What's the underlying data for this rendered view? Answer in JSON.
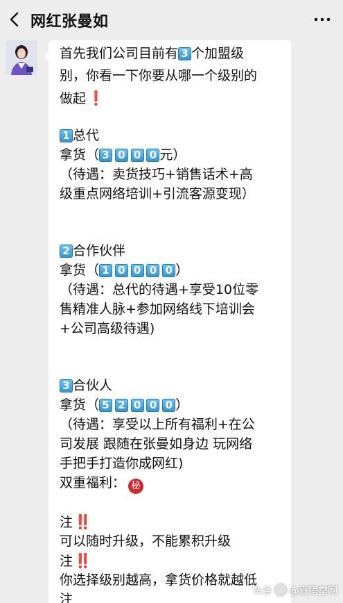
{
  "header": {
    "title": "网红张曼如",
    "back_icon": "chevron-left-icon",
    "more_icon": "ellipsis-icon"
  },
  "message": {
    "avatar_icon": "avatar",
    "bubble_color": "#ffffff",
    "box_color": "#2f93d8",
    "alert_color": "#d91e2a",
    "intro": {
      "l1a": "首先我们公司目前有",
      "l1num": "3",
      "l1b": "个加盟级",
      "l2": "别，你看一下你要从哪一个级别的",
      "l3": "做起",
      "l3mark": "❗"
    },
    "tier1": {
      "num": "1",
      "name": "总代",
      "price_prefix": "拿货（",
      "price_digits": [
        "3",
        "0",
        "0",
        "0"
      ],
      "price_suffix": "元）",
      "benefit1": "（待遇：卖货技巧+销售话术+高",
      "benefit2": "级重点网络培训+引流客源变现）"
    },
    "tier2": {
      "num": "2",
      "name": "合作伙伴",
      "price_prefix": "拿货（",
      "price_digits": [
        "1",
        "0",
        "0",
        "0",
        "0"
      ],
      "price_suffix": "）",
      "benefit1": "（待遇：总代的待遇+享受10位零",
      "benefit2": "售精准人脉+参加网络线下培训会",
      "benefit3": "+公司高级待遇)"
    },
    "tier3": {
      "num": "3",
      "name": "合伙人",
      "price_prefix": "拿货（",
      "price_digits": [
        "5",
        "2",
        "0",
        "0",
        "0"
      ],
      "price_suffix": "）",
      "benefit1": "（待遇：享受以上所有福利+在公",
      "benefit2": "司发展 跟随在张曼如身边 玩网络",
      "benefit3": "手把手打造你成网红)",
      "double_benefit": "双重福利：",
      "secret_glyph": "秘"
    },
    "notes": {
      "label1": "注",
      "mark1": "‼️",
      "text1": "可以随时升级，不能累积升级",
      "label2": "注",
      "mark2": "‼️",
      "text2": "你选择级别越高，拿货价格就越低",
      "label3": "注"
    }
  },
  "watermark": {
    "text_a": "头条",
    "text_b": "@直销堂网"
  }
}
